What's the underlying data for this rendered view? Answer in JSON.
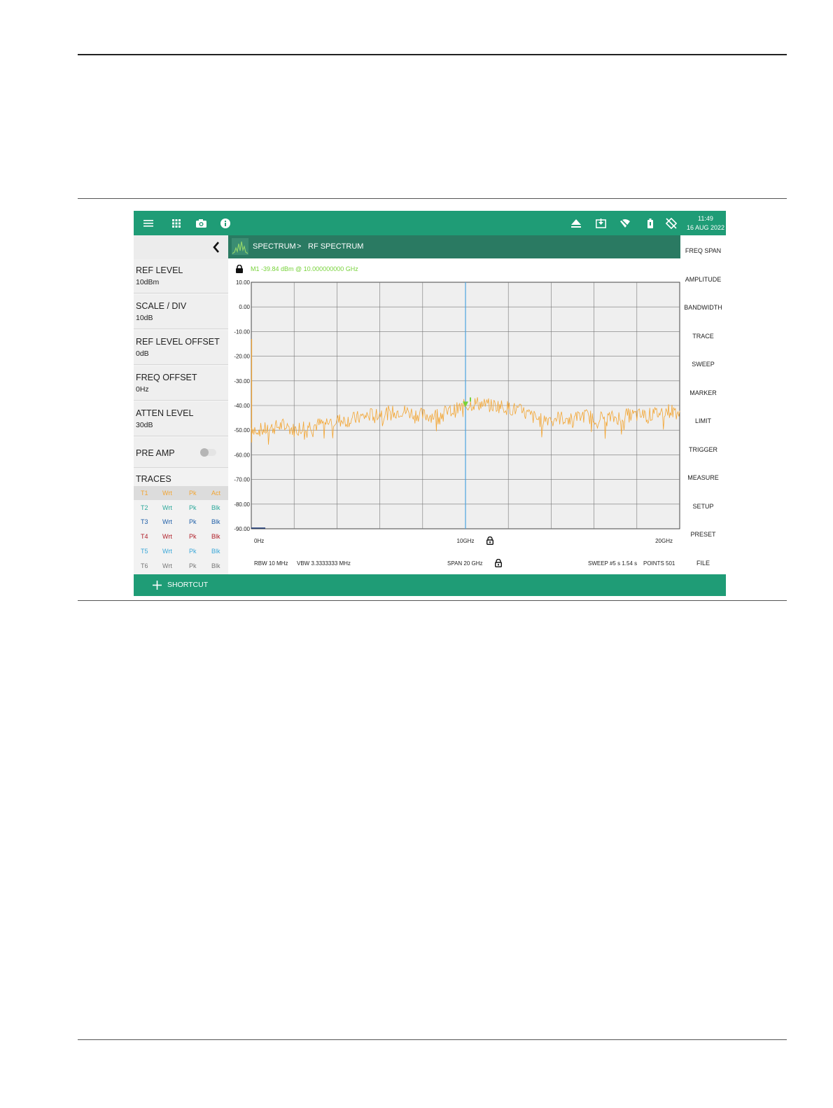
{
  "statusbar": {
    "time": "11:49",
    "date": "16 AUG 2022",
    "icons": [
      "menu-icon",
      "apps-grid-icon",
      "camera-icon",
      "info-icon",
      "eject-icon",
      "download-icon",
      "wifi-off-icon",
      "battery-icon",
      "rotation-lock-icon"
    ]
  },
  "breadcrumb": {
    "section": "SPECTRUM",
    "separator": ">",
    "page": "RF SPECTRUM"
  },
  "left_panel": {
    "items": [
      {
        "title": "REF LEVEL",
        "value": "10dBm"
      },
      {
        "title": "SCALE / DIV",
        "value": "10dB"
      },
      {
        "title": "REF LEVEL OFFSET",
        "value": "0dB"
      },
      {
        "title": "FREQ OFFSET",
        "value": "0Hz"
      },
      {
        "title": "ATTEN LEVEL",
        "value": "30dB"
      }
    ],
    "pre_amp": {
      "label": "PRE AMP",
      "on": false
    },
    "traces_title": "TRACES",
    "traces": [
      {
        "name": "T1",
        "mode": "Wrt",
        "detector": "Pk",
        "state": "Act",
        "color": "#f2a533"
      },
      {
        "name": "T2",
        "mode": "Wrt",
        "detector": "Pk",
        "state": "Blk",
        "color": "#2aa89a"
      },
      {
        "name": "T3",
        "mode": "Wrt",
        "detector": "Pk",
        "state": "Blk",
        "color": "#1f5fa8"
      },
      {
        "name": "T4",
        "mode": "Wrt",
        "detector": "Pk",
        "state": "Blk",
        "color": "#b0202a"
      },
      {
        "name": "T5",
        "mode": "Wrt",
        "detector": "Pk",
        "state": "Blk",
        "color": "#3aa7d8"
      },
      {
        "name": "T6",
        "mode": "Wrt",
        "detector": "Pk",
        "state": "Blk",
        "color": "#777777"
      }
    ]
  },
  "marker_readout": "M1   -39.84 dBm @ 10.000000000 GHz",
  "chart_data": {
    "type": "line",
    "y_ticks": [
      "10.00",
      "0.00",
      "-10.00",
      "-20.00",
      "-30.00",
      "-40.00",
      "-50.00",
      "-60.00",
      "-70.00",
      "-80.00",
      "-90.00"
    ],
    "ylim": [
      -90,
      10
    ],
    "xlim": [
      0,
      20
    ],
    "x_tick_labels": [
      "0Hz",
      "10GHz",
      "20GHz"
    ],
    "x_tick_values": [
      0,
      10,
      20
    ],
    "grid": true,
    "trace_color": "#f2a533",
    "marker": {
      "name": "M1",
      "x": 10.0,
      "y": -39.84,
      "color": "#77d23a"
    },
    "series": [
      {
        "x": [
          0,
          0.5,
          1,
          1.5,
          2,
          2.5,
          3,
          3.5,
          4,
          4.5,
          5,
          5.5,
          6,
          6.5,
          7,
          7.5,
          8,
          8.5,
          9,
          9.5,
          10,
          10.5,
          11,
          11.5,
          12,
          12.5,
          13,
          13.5,
          14,
          14.5,
          15,
          15.5,
          16,
          16.5,
          17,
          17.5,
          18,
          18.5,
          19,
          19.5,
          20
        ],
        "values": [
          -49,
          -50,
          -49,
          -48,
          -50,
          -48,
          -48,
          -47,
          -46,
          -46,
          -45,
          -44,
          -43,
          -43,
          -42,
          -43,
          -44,
          -44,
          -43,
          -42,
          -40,
          -39,
          -40,
          -40,
          -41,
          -42,
          -44,
          -46,
          -45,
          -45,
          -46,
          -44,
          -45,
          -45,
          -45,
          -44,
          -44,
          -44,
          -43,
          -42,
          -43
        ]
      }
    ]
  },
  "bottom_info": {
    "rbw": "RBW 10 MHz",
    "vbw": "VBW 3.3333333 MHz",
    "span": "SPAN 20 GHz",
    "sweep": "SWEEP  #5 s  1.54 s",
    "points": "POINTS 501"
  },
  "right_menu": [
    "FREQ SPAN",
    "AMPLITUDE",
    "BANDWIDTH",
    "TRACE",
    "SWEEP",
    "MARKER",
    "LIMIT",
    "TRIGGER",
    "MEASURE",
    "SETUP",
    "PRESET",
    "FILE"
  ],
  "shortcut_label": "SHORTCUT"
}
